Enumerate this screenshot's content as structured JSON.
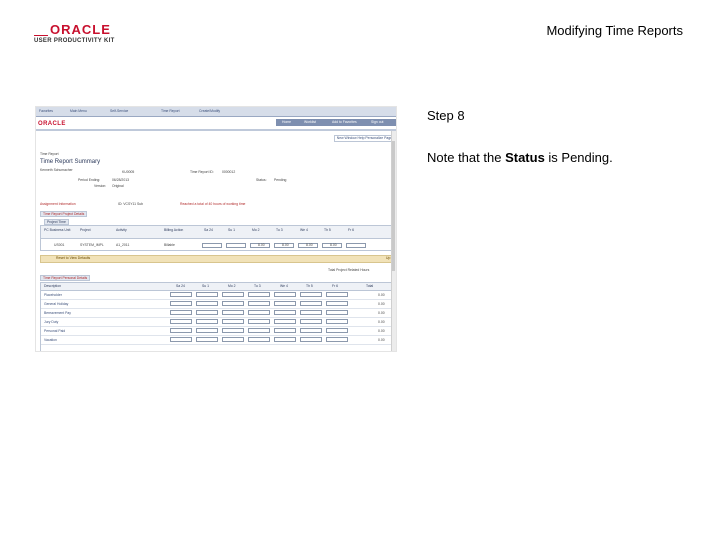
{
  "header": {
    "logo_word": "ORACLE",
    "logo_sub": "USER PRODUCTIVITY KIT",
    "doc_title": "Modifying Time Reports"
  },
  "step": {
    "label": "Step 8",
    "text_before": "Note that the ",
    "text_bold": "Status",
    "text_after": " is Pending."
  },
  "screenshot": {
    "nav": [
      "Favorites",
      "Main Menu",
      "Self-Service",
      "Time Report",
      "Create/Modify"
    ],
    "brand": "ORACLE",
    "top_links": [
      "Home",
      "Worklist",
      "Add to Favorites",
      "Sign out"
    ],
    "pers_text": "New Window  Help  Personalize Page",
    "breadcrumb": "Time Report",
    "heading": "Time Report Summary",
    "employee": "Kenneth Schumacher",
    "employee_id": "KU0005",
    "report_id_label": "Time Report ID:",
    "report_id": "0000012",
    "period_label": "Period Ending:",
    "period": "06/28/2013",
    "status_label": "Status:",
    "status": "Pending",
    "version_label": "Version:",
    "version": "Original",
    "assignment_label": "Assignment Information",
    "assignment": "ID:  VCSY11 Sub",
    "warning": "Reached a total of 40 hours of working time",
    "section1": "Time Report Project Details",
    "subtab1": "Project Time",
    "grid1_cols": [
      "PC Business Unit",
      "Project",
      "Activity",
      "Billing Action",
      "Sa 24",
      "Su 1",
      "Mo 2",
      "Tu 3",
      "We 4",
      "Th 5",
      "Fr 6"
    ],
    "grid1_values": [
      "US001",
      "SYSTEM_IMPL",
      "A1_2011",
      "Billable",
      "",
      "",
      "8.00",
      "8.00",
      "8.00",
      "8.00",
      ""
    ],
    "button": "Reset to View Defaults",
    "button_right": "Up",
    "total_label": "Total Project Related Hours",
    "section2": "Time Report Personal Details",
    "grid2_cols": [
      "Description",
      "Sa 24",
      "Su 1",
      "Mo 2",
      "Tu 3",
      "We 4",
      "Th 5",
      "Fr 6",
      "Total"
    ],
    "grid2_rows": [
      {
        "label": "Placeholder",
        "total": "0.00"
      },
      {
        "label": "General Holiday",
        "total": "0.00"
      },
      {
        "label": "Bereavement Pay",
        "total": "0.00"
      },
      {
        "label": "Jury Duty",
        "total": "0.00"
      },
      {
        "label": "Personal Paid",
        "total": "0.00"
      },
      {
        "label": "Vacation",
        "total": "0.00"
      }
    ],
    "personal_paid_value": "8.00"
  }
}
